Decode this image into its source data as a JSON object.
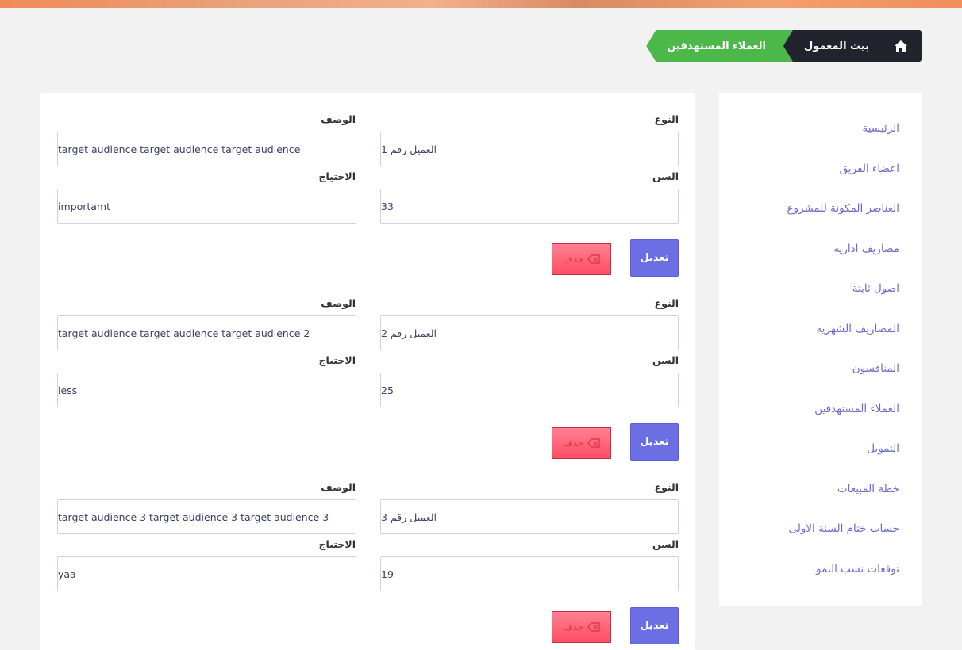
{
  "breadcrumb": {
    "home_icon": "home-icon",
    "items": [
      "بيت المعمول",
      "العملاء المستهدفين"
    ]
  },
  "sidebar": {
    "items": [
      "الرئيسية",
      "اعضاء الفريق",
      "العناصر المكونة للمشروع",
      "مصاريف ادارية",
      "اصول ثابتة",
      "المصاريف الشهرية",
      "المنافسون",
      "العملاء المستهدفين",
      "التمويل",
      "خطة المبيعات",
      "حساب ختام السنة الاولى",
      "توقعات نسب النمو"
    ]
  },
  "labels": {
    "type": "النوع",
    "description": "الوصف",
    "age": "السن",
    "need": "الاحتياج",
    "edit": "تعديل",
    "delete": "حذف"
  },
  "records": [
    {
      "type": "العميل رقم 1",
      "description": "target audience target audience target audience",
      "age": "33",
      "need": "importamt"
    },
    {
      "type": "العميل رقم  2",
      "description": "target audience  target audience  target audience 2",
      "age": "25",
      "need": "less"
    },
    {
      "type": "العميل رقم 3",
      "description": "target audience 3 target audience 3 target audience 3",
      "age": "19",
      "need": "yaa"
    }
  ],
  "colors": {
    "accent": "#6c6fe4",
    "breadcrumb_dark": "#22232d",
    "breadcrumb_active": "#4db84a",
    "delete": "#ff4d64",
    "sidebar_link": "#6a6acf"
  }
}
